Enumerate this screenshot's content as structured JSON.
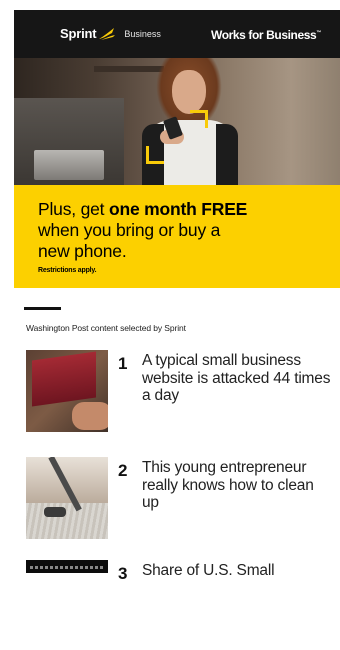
{
  "ad": {
    "brand": "Sprint",
    "brand_sub": "Business",
    "tagline": "Works for Business",
    "tagline_mark": "™",
    "promo": {
      "line1_pre": "Plus, get ",
      "line1_bold": "one month FREE",
      "line2": "when you bring or buy a",
      "line3": "new phone.",
      "note": "Restrictions apply."
    },
    "colors": {
      "accent": "#fcd000",
      "dark": "#161616"
    }
  },
  "source": "Washington Post content selected by Sprint",
  "articles": [
    {
      "number": "1",
      "title": "A typical small business website is attacked 44 times a day",
      "thumb_icon": "laptop-hands-photo"
    },
    {
      "number": "2",
      "title": "This young entrepreneur really knows how to clean up",
      "thumb_icon": "vacuum-cleaner-photo"
    },
    {
      "number": "3",
      "title": "Share of U.S. Small",
      "thumb_icon": "dark-text-photo"
    }
  ]
}
